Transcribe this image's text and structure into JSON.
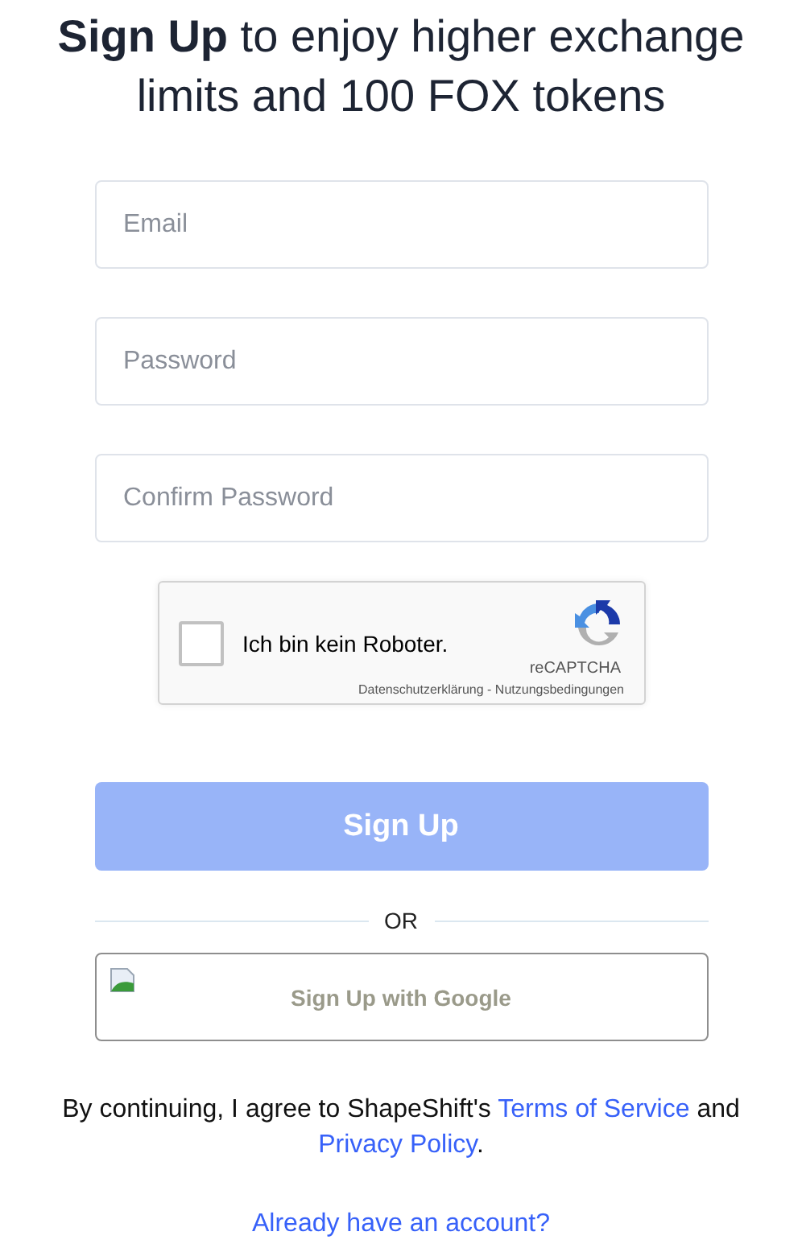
{
  "heading": "**Sign Up** to enjoy higher exchange limits and 100 FOX tokens",
  "fields": [
    {
      "placeholder": "Email"
    },
    {
      "placeholder": "Password"
    },
    {
      "placeholder": "Confirm Password"
    }
  ],
  "captcha": {
    "label": "Ich bin kein Roboter.",
    "checked": false,
    "brand": "reCAPTCHA",
    "links": "Datenschutzerklärung - Nutzungsbedingungen"
  },
  "submit": {
    "label": "Sign Up",
    "disabled": true
  },
  "divider": "OR",
  "google_button": {
    "label": "Sign Up with Google"
  },
  "terms": {
    "text": "By continuing, I agree to ShapeShift's",
    "terms_link": "Terms of Service",
    "and": "and",
    "privacy_link": "Privacy Policy",
    "end": "."
  },
  "login_link": "Already have an account?"
}
